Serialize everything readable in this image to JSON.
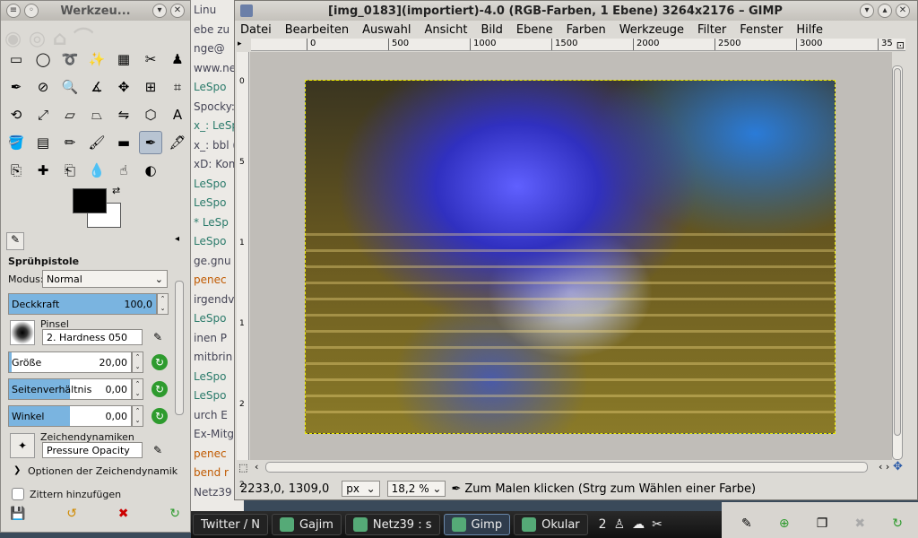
{
  "toolbox": {
    "title": "Werkzeu...",
    "tools": [
      "rect-select-icon",
      "ellipse-select-icon",
      "lasso-icon",
      "fuzzy-select-icon",
      "color-select-icon",
      "scissors-select-icon",
      "foreground-select-icon",
      "paths-icon",
      "color-picker-icon",
      "zoom-icon",
      "measure-icon",
      "move-icon",
      "align-icon",
      "crop-icon",
      "rotate-icon",
      "scale-icon",
      "shear-icon",
      "perspective-icon",
      "flip-icon",
      "cage-icon",
      "text-icon",
      "bucket-fill-icon",
      "blend-icon",
      "pencil-icon",
      "paintbrush-icon",
      "eraser-icon",
      "airbrush-icon",
      "ink-icon",
      "clone-icon",
      "heal-icon",
      "perspective-clone-icon",
      "blur-icon",
      "smudge-icon",
      "dodge-burn-icon"
    ],
    "options": {
      "tool_name": "Sprühpistole",
      "mode_label": "Modus:",
      "mode_value": "Normal",
      "opacity_label": "Deckkraft",
      "opacity_value": "100,0",
      "brush_label": "Pinsel",
      "brush_value": "2. Hardness 050",
      "size_label": "Größe",
      "size_value": "20,00",
      "aspect_label": "Seitenverhältnis",
      "aspect_value": "0,00",
      "angle_label": "Winkel",
      "angle_value": "0,00",
      "dynamics_label": "Zeichendynamiken",
      "dynamics_value": "Pressure Opacity",
      "dynamics_options_label": "Optionen der Zeichendynamik",
      "jitter_label": "Zittern hinzufügen"
    }
  },
  "image_window": {
    "title": "[img_0183](importiert)-4.0 (RGB-Farben, 1 Ebene) 3264x2176 – GIMP",
    "menu": [
      "Datei",
      "Bearbeiten",
      "Auswahl",
      "Ansicht",
      "Bild",
      "Ebene",
      "Farben",
      "Werkzeuge",
      "Filter",
      "Fenster",
      "Hilfe"
    ],
    "ruler_ticks": [
      "0",
      "500",
      "1000",
      "1500",
      "2000",
      "2500",
      "3000",
      "35"
    ],
    "vruler_ticks": [
      "0",
      "5",
      "1",
      "1",
      "2",
      "2"
    ],
    "status": {
      "coords": "2233,0, 1309,0",
      "unit": "px",
      "zoom": "18,2 %",
      "message": "Zum Malen klicken (Strg zum Wählen einer Farbe)"
    }
  },
  "background_chat": {
    "lines": [
      "Linu",
      "ebe zu",
      "nge@",
      "www.ne",
      "LeSpo",
      "Spocky: b",
      "x_: LeSp",
      "x_: bbl (H",
      "xD: Kom",
      "LeSpo",
      "LeSpo",
      "* LeSp",
      "LeSpo",
      "ge.gnu",
      "penec",
      "irgendv",
      "LeSpo",
      "inen P",
      "mitbrin",
      "LeSpo",
      "LeSpo",
      "urch E",
      "Ex-Mitg",
      "penec",
      "bend r",
      "Netz39"
    ]
  },
  "taskbar": {
    "items": [
      {
        "label": "Twitter / N",
        "active": false
      },
      {
        "label": "Gajim",
        "active": false
      },
      {
        "label": "Netz39 : s",
        "active": false
      },
      {
        "label": "Gimp",
        "active": true
      },
      {
        "label": "Okular",
        "active": false
      }
    ],
    "tray_count": "2"
  },
  "colors": {
    "accent": "#7ab4e0",
    "reset": "#2e9b2e"
  }
}
